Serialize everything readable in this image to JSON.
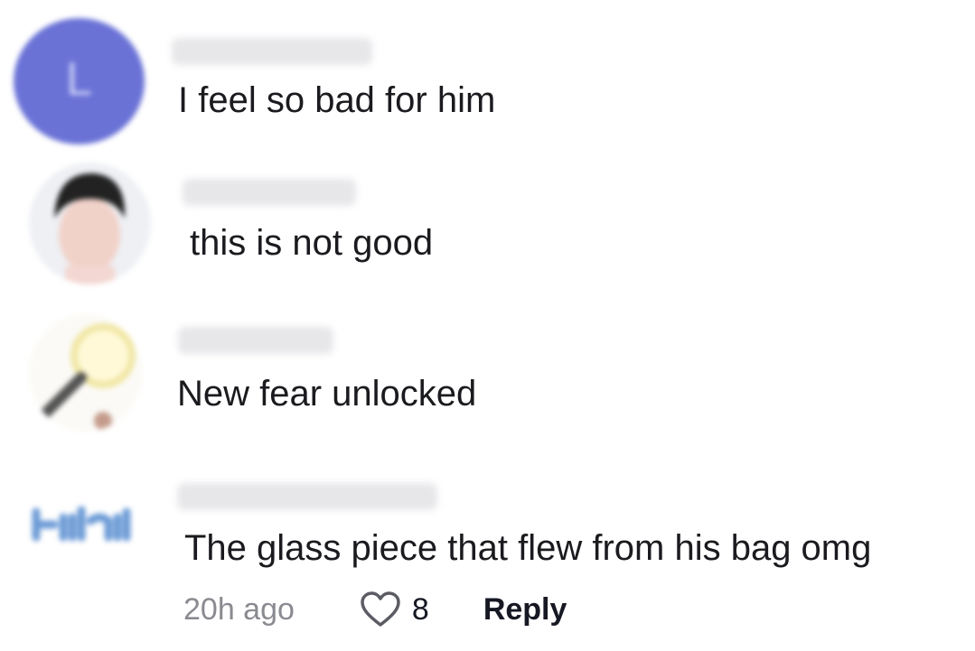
{
  "comments": [
    {
      "avatar_letter": "L",
      "avatar_color": "#6a72d6",
      "text": "I feel so bad for him"
    },
    {
      "avatar_icon": "person-photo-icon",
      "text": "this is not good"
    },
    {
      "avatar_icon": "magnifier-icon",
      "text": "New fear unlocked"
    },
    {
      "avatar_icon": "blue-logo-icon",
      "text": "The glass piece that flew from his bag omg",
      "time": "20h ago",
      "likes": "8",
      "reply_label": "Reply"
    }
  ]
}
